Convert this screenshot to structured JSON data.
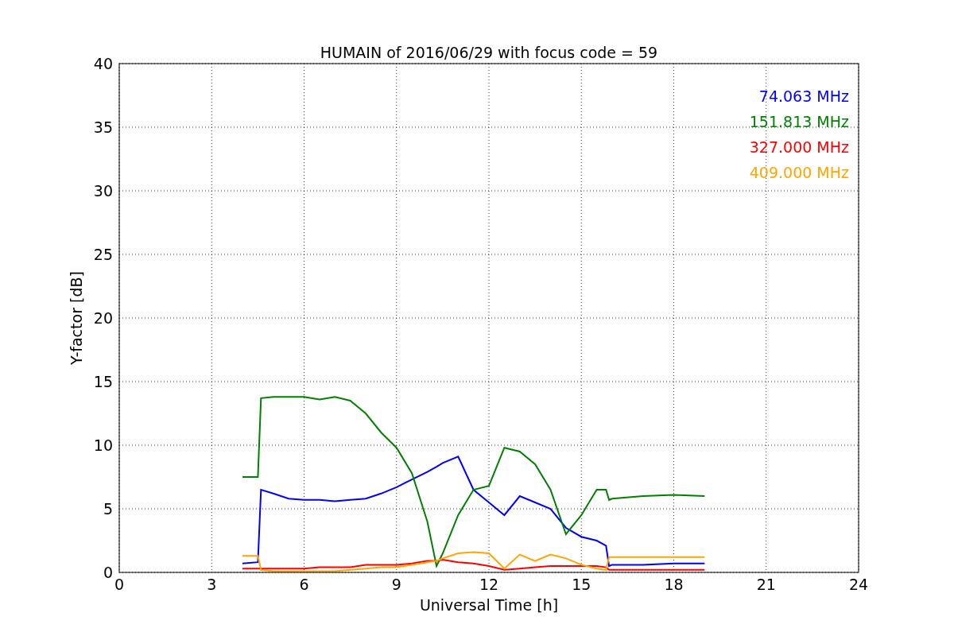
{
  "chart_data": {
    "type": "line",
    "title": "HUMAIN of 2016/06/29 with focus code = 59",
    "xlabel": "Universal Time [h]",
    "ylabel": "Y-factor [dB]",
    "xlim": [
      0,
      24
    ],
    "ylim": [
      0,
      40
    ],
    "xticks": [
      0,
      3,
      6,
      9,
      12,
      15,
      18,
      21,
      24
    ],
    "yticks": [
      0,
      5,
      10,
      15,
      20,
      25,
      30,
      35,
      40
    ],
    "grid": true,
    "x": [
      4,
      4.5,
      4.6,
      5,
      5.5,
      6,
      6.5,
      7,
      7.5,
      8,
      8.5,
      9,
      9.5,
      10,
      10.3,
      10.5,
      11,
      11.5,
      12,
      12.5,
      13,
      13.5,
      14,
      14.5,
      15,
      15.5,
      15.8,
      15.9,
      16,
      17,
      18,
      19
    ],
    "series": [
      {
        "name": "74.063 MHz",
        "color": "#0000ff",
        "values": [
          0.7,
          0.8,
          6.5,
          6.2,
          5.8,
          5.7,
          5.7,
          5.6,
          5.7,
          5.8,
          6.2,
          6.7,
          7.3,
          7.9,
          8.3,
          8.6,
          9.1,
          6.5,
          5.5,
          4.5,
          6,
          5.5,
          5,
          3.5,
          2.8,
          2.5,
          2.1,
          0.5,
          0.6,
          0.6,
          0.7,
          0.7
        ]
      },
      {
        "name": "151.813 MHz",
        "color": "#008000",
        "values": [
          7.5,
          7.5,
          13.7,
          13.8,
          13.8,
          13.8,
          13.6,
          13.8,
          13.5,
          12.5,
          11,
          9.8,
          7.8,
          4,
          0.5,
          1.5,
          4.5,
          6.5,
          6.8,
          9.8,
          9.5,
          8.5,
          6.5,
          3,
          4.5,
          6.5,
          6.5,
          5.7,
          5.8,
          6,
          6.1,
          6
        ]
      },
      {
        "name": "327.000 MHz",
        "color": "#ff0000",
        "values": [
          0.3,
          0.3,
          0.3,
          0.3,
          0.3,
          0.3,
          0.4,
          0.4,
          0.4,
          0.6,
          0.6,
          0.6,
          0.7,
          0.9,
          0.9,
          1,
          0.8,
          0.7,
          0.5,
          0.2,
          0.3,
          0.4,
          0.5,
          0.5,
          0.5,
          0.5,
          0.4,
          0.2,
          0.2,
          0.2,
          0.2,
          0.2
        ]
      },
      {
        "name": "409.000 MHz",
        "color": "#ffa500",
        "values": [
          1.3,
          1.3,
          0.2,
          0.1,
          0.1,
          0.1,
          0.1,
          0.1,
          0.2,
          0.3,
          0.4,
          0.4,
          0.6,
          0.8,
          0.9,
          1.1,
          1.5,
          1.6,
          1.5,
          0.3,
          1.4,
          0.9,
          1.4,
          1.1,
          0.6,
          0.3,
          0.2,
          1.2,
          1.2,
          1.2,
          1.2,
          1.2
        ]
      }
    ]
  }
}
